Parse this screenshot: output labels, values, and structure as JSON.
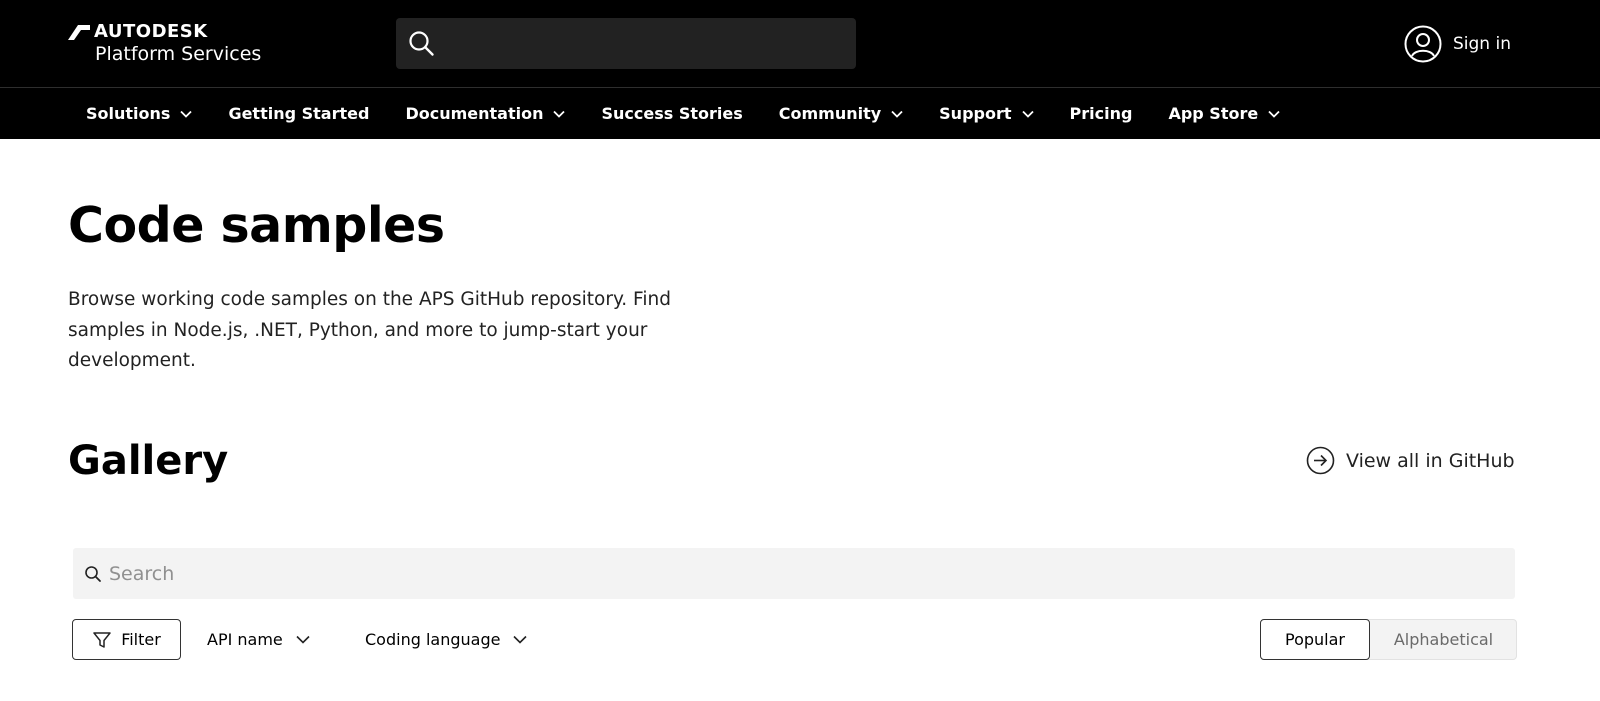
{
  "header": {
    "logo_brand": "AUTODESK",
    "logo_product": "Platform Services",
    "sign_in_label": "Sign in"
  },
  "nav": {
    "items": [
      {
        "label": "Solutions",
        "has_dropdown": true
      },
      {
        "label": "Getting Started",
        "has_dropdown": false
      },
      {
        "label": "Documentation",
        "has_dropdown": true
      },
      {
        "label": "Success Stories",
        "has_dropdown": false
      },
      {
        "label": "Community",
        "has_dropdown": true
      },
      {
        "label": "Support",
        "has_dropdown": true
      },
      {
        "label": "Pricing",
        "has_dropdown": false
      },
      {
        "label": "App Store",
        "has_dropdown": true
      }
    ]
  },
  "main": {
    "title": "Code samples",
    "intro": "Browse working code samples on the APS GitHub repository. Find samples in Node.js, .NET, Python, and more to jump-start your development.",
    "gallery_title": "Gallery",
    "github_link_label": "View all in GitHub"
  },
  "gallery": {
    "search_placeholder": "Search",
    "filter_label": "Filter",
    "api_dropdown_label": "API name",
    "language_dropdown_label": "Coding language",
    "sort_options": {
      "popular": "Popular",
      "alphabetical": "Alphabetical"
    },
    "sort_selected": "Popular"
  },
  "colors": {
    "header_bg": "#000000",
    "header_search_bg": "#222222",
    "search_bg": "#f3f3f3",
    "text": "#000000"
  },
  "icons": [
    "autodesk-logo-icon",
    "search-icon",
    "user-icon",
    "chevron-down-icon",
    "arrow-right-circle-icon",
    "funnel-icon"
  ]
}
